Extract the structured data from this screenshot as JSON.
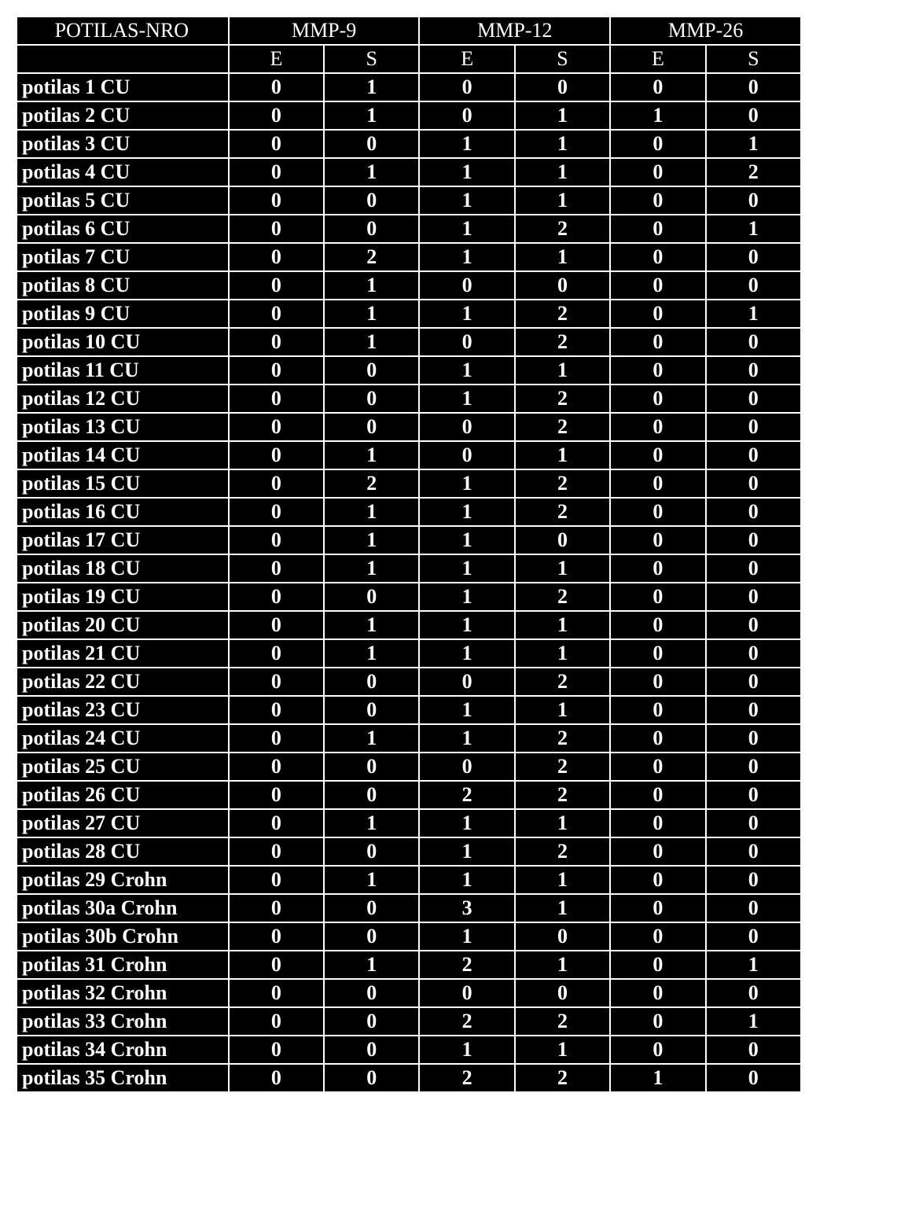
{
  "headers": {
    "rowhead": "POTILAS-NRO",
    "groups": [
      "MMP-9",
      "MMP-12",
      "MMP-26"
    ],
    "sub": [
      "E",
      "S"
    ]
  },
  "rows": [
    {
      "label": "potilas 1 CU",
      "v": [
        0,
        1,
        0,
        0,
        0,
        0
      ]
    },
    {
      "label": "potilas 2 CU",
      "v": [
        0,
        1,
        0,
        1,
        1,
        0
      ]
    },
    {
      "label": "potilas 3 CU",
      "v": [
        0,
        0,
        1,
        1,
        0,
        1
      ]
    },
    {
      "label": "potilas 4 CU",
      "v": [
        0,
        1,
        1,
        1,
        0,
        2
      ]
    },
    {
      "label": "potilas 5 CU",
      "v": [
        0,
        0,
        1,
        1,
        0,
        0
      ]
    },
    {
      "label": "potilas 6 CU",
      "v": [
        0,
        0,
        1,
        2,
        0,
        1
      ]
    },
    {
      "label": "potilas 7 CU",
      "v": [
        0,
        2,
        1,
        1,
        0,
        0
      ]
    },
    {
      "label": "potilas 8 CU",
      "v": [
        0,
        1,
        0,
        0,
        0,
        0
      ]
    },
    {
      "label": "potilas 9 CU",
      "v": [
        0,
        1,
        1,
        2,
        0,
        1
      ]
    },
    {
      "label": "potilas 10 CU",
      "v": [
        0,
        1,
        0,
        2,
        0,
        0
      ]
    },
    {
      "label": "potilas 11 CU",
      "v": [
        0,
        0,
        1,
        1,
        0,
        0
      ]
    },
    {
      "label": "potilas 12 CU",
      "v": [
        0,
        0,
        1,
        2,
        0,
        0
      ]
    },
    {
      "label": "potilas 13 CU",
      "v": [
        0,
        0,
        0,
        2,
        0,
        0
      ]
    },
    {
      "label": "potilas 14 CU",
      "v": [
        0,
        1,
        0,
        1,
        0,
        0
      ]
    },
    {
      "label": "potilas 15 CU",
      "v": [
        0,
        2,
        1,
        2,
        0,
        0
      ]
    },
    {
      "label": "potilas 16 CU",
      "v": [
        0,
        1,
        1,
        2,
        0,
        0
      ]
    },
    {
      "label": "potilas 17 CU",
      "v": [
        0,
        1,
        1,
        0,
        0,
        0
      ]
    },
    {
      "label": "potilas 18 CU",
      "v": [
        0,
        1,
        1,
        1,
        0,
        0
      ]
    },
    {
      "label": "potilas 19 CU",
      "v": [
        0,
        0,
        1,
        2,
        0,
        0
      ]
    },
    {
      "label": "potilas 20 CU",
      "v": [
        0,
        1,
        1,
        1,
        0,
        0
      ]
    },
    {
      "label": "potilas 21 CU",
      "v": [
        0,
        1,
        1,
        1,
        0,
        0
      ]
    },
    {
      "label": "potilas 22 CU",
      "v": [
        0,
        0,
        0,
        2,
        0,
        0
      ]
    },
    {
      "label": "potilas 23 CU",
      "v": [
        0,
        0,
        1,
        1,
        0,
        0
      ]
    },
    {
      "label": "potilas 24 CU",
      "v": [
        0,
        1,
        1,
        2,
        0,
        0
      ]
    },
    {
      "label": "potilas 25 CU",
      "v": [
        0,
        0,
        0,
        2,
        0,
        0
      ]
    },
    {
      "label": "potilas 26 CU",
      "v": [
        0,
        0,
        2,
        2,
        0,
        0
      ]
    },
    {
      "label": "potilas 27 CU",
      "v": [
        0,
        1,
        1,
        1,
        0,
        0
      ]
    },
    {
      "label": "potilas 28 CU",
      "v": [
        0,
        0,
        1,
        2,
        0,
        0
      ]
    },
    {
      "label": "potilas 29 Crohn",
      "v": [
        0,
        1,
        1,
        1,
        0,
        0
      ]
    },
    {
      "label": "potilas 30a Crohn",
      "v": [
        0,
        0,
        3,
        1,
        0,
        0
      ]
    },
    {
      "label": "potilas 30b Crohn",
      "v": [
        0,
        0,
        1,
        0,
        0,
        0
      ]
    },
    {
      "label": "potilas 31 Crohn",
      "v": [
        0,
        1,
        2,
        1,
        0,
        1
      ]
    },
    {
      "label": "potilas 32 Crohn",
      "v": [
        0,
        0,
        0,
        0,
        0,
        0
      ]
    },
    {
      "label": "potilas 33 Crohn",
      "v": [
        0,
        0,
        2,
        2,
        0,
        1
      ]
    },
    {
      "label": "potilas 34 Crohn",
      "v": [
        0,
        0,
        1,
        1,
        0,
        0
      ]
    },
    {
      "label": "potilas 35 Crohn",
      "v": [
        0,
        0,
        2,
        2,
        1,
        0
      ]
    }
  ]
}
